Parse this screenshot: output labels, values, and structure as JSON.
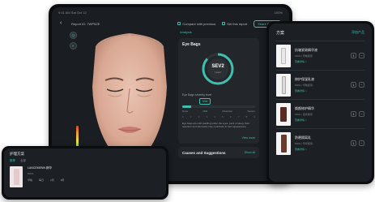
{
  "tablet": {
    "status_left": "9:41 AM  Sat Oct 12",
    "status_right": "100%",
    "report_label": "Report ID: 7WP5ZE",
    "toggle_all": "Compare with previous",
    "toggle_report": "Set this report",
    "pill": "Share Report"
  },
  "analysis": {
    "tab": "Analysis",
    "card_title": "Eye Bags",
    "gauge_value": "SEV2",
    "gauge_sub": "Level",
    "gauge_level": 0.12,
    "severity_label": "Eye Bags severity level",
    "severity_tag": "Mild",
    "levels": [
      "None",
      "Mild",
      "Moderate",
      "Severe"
    ],
    "ticks": [
      "0",
      "1",
      "2",
      "3",
      "4",
      "5",
      "6",
      "7",
      "8",
      "9"
    ],
    "description": "Eye bags are mild swelling under the eyes. Lack of sleep, fluid retention and skin laxity may contribute to their appearance.",
    "more": "View more",
    "causes_title": "Causes and Suggestions",
    "causes_more": "Show all"
  },
  "products": {
    "title": "方案",
    "add": "添加产品",
    "items": [
      {
        "name": "抗皱紧致精华液",
        "sub": "30ML | 早晚使用",
        "action": "查看详情 >",
        "qty": "1"
      },
      {
        "name": "修护保湿乳液",
        "sub": "50ML | 早晚使用",
        "action": "查看详情 >",
        "qty": "1"
      },
      {
        "name": "焕颜修护精华",
        "sub": "30ML | 夜间使用",
        "action": "查看详情 >",
        "qty": "1"
      },
      {
        "name": "防晒隔离乳",
        "sub": "50ML | 早间使用",
        "action": "查看详情 >",
        "qty": "1"
      }
    ]
  },
  "mini": {
    "title": "护理方案",
    "tabs": [
      "推荐",
      "全部"
    ],
    "product_name": "LANCEMENN 精华",
    "product_sub": "50ML",
    "stats": [
      "早晚",
      "每日",
      "2周",
      "8周"
    ]
  },
  "colors": {
    "accent": "#3fbfae",
    "panel": "#23272c",
    "bg": "#1a1d21"
  }
}
